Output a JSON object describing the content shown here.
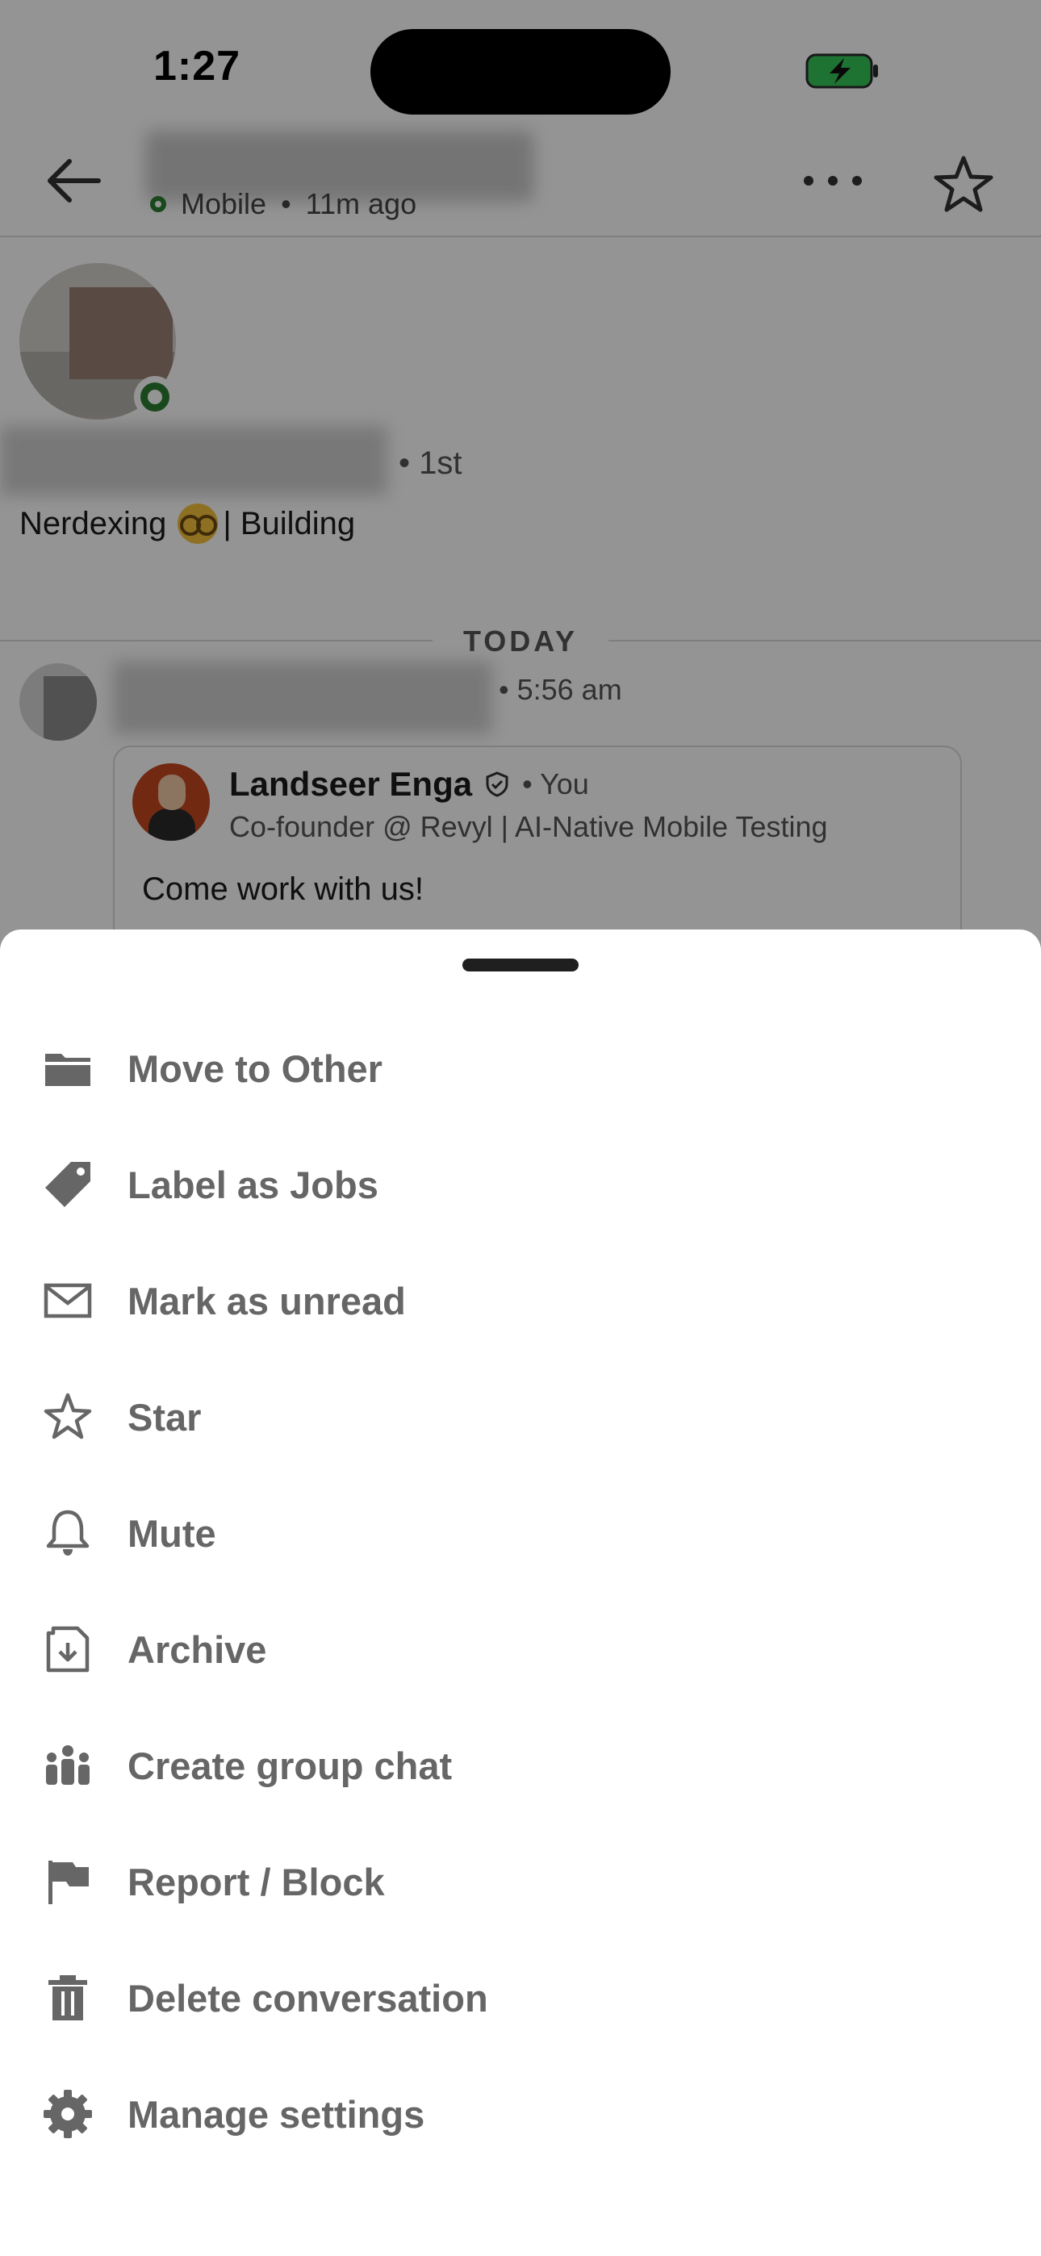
{
  "status_bar": {
    "time": "1:27"
  },
  "header": {
    "presence": "Mobile",
    "last_seen": "11m ago"
  },
  "profile": {
    "degree": "• 1st",
    "headline_pre": "Nerdexing",
    "headline_post": "| Building"
  },
  "conversation": {
    "day_divider": "TODAY",
    "message_time": "5:56 am",
    "shared_post": {
      "author": "Landseer Enga",
      "you_tag": "• You",
      "author_title": "Co-founder @ Revyl | AI-Native Mobile Testing",
      "text": "Come work with us!"
    }
  },
  "sheet": {
    "items": [
      {
        "label": "Move to Other",
        "icon": "folder-icon"
      },
      {
        "label": "Label as Jobs",
        "icon": "tag-icon"
      },
      {
        "label": "Mark as unread",
        "icon": "envelope-icon"
      },
      {
        "label": "Star",
        "icon": "star-icon"
      },
      {
        "label": "Mute",
        "icon": "bell-icon"
      },
      {
        "label": "Archive",
        "icon": "archive-icon"
      },
      {
        "label": "Create group chat",
        "icon": "people-icon"
      },
      {
        "label": "Report / Block",
        "icon": "flag-icon"
      },
      {
        "label": "Delete conversation",
        "icon": "trash-icon"
      },
      {
        "label": "Manage settings",
        "icon": "gear-icon"
      }
    ]
  },
  "colors": {
    "online_green": "#2e7d32",
    "menu_text": "#666666",
    "battery_green": "#34c759"
  }
}
